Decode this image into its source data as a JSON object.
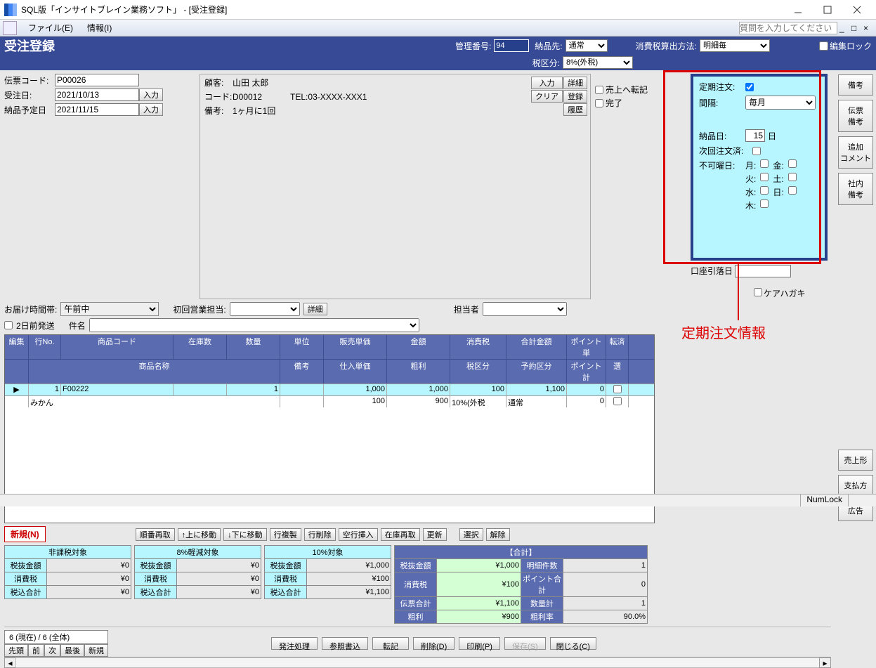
{
  "window": {
    "title": "SQL版「インサイトブレイン業務ソフト」 - [受注登録]"
  },
  "menu": {
    "file": "ファイル(E)",
    "info": "情報(I)",
    "searchPlaceholder": "質問を入力してください"
  },
  "header": {
    "pagetitle": "受注登録",
    "mgmtnum_label": "管理番号:",
    "mgmtnum": "94",
    "dest_label": "納品先:",
    "dest": "通常",
    "taxmethod_label": "消費税算出方法:",
    "taxmethod": "明細毎",
    "taxcat_label": "税区分:",
    "taxcat": "8%(外税)",
    "editlock": "編集ロック"
  },
  "form": {
    "slipcode_l": "伝票コード:",
    "slipcode": "P00026",
    "orderdate_l": "受注日:",
    "orderdate": "2021/10/13",
    "input": "入力",
    "delivdate_l": "納品予定日",
    "delivdate": "2021/11/15",
    "customer_l": "顧客:",
    "customer": "山田 太郎",
    "code_l": "コード:",
    "code": "D00012",
    "tel_l": "TEL:",
    "tel": "03-XXXX-XXX1",
    "remark_l": "備考:",
    "remark": "1ヶ月に1回",
    "btn_input": "入力",
    "btn_detail": "詳細",
    "btn_clear": "クリア",
    "btn_reg": "登録",
    "btn_hist": "履歴",
    "tosales": "売上へ転記",
    "done": "完了",
    "delivtime_l": "お届け時間帯:",
    "delivtime": "午前中",
    "firstrep_l": "初回営業担当:",
    "detail2": "詳細",
    "rep_l": "担当者",
    "twoday": "2日前発送",
    "subject_l": "件名"
  },
  "grid": {
    "edit": "編集",
    "h1": [
      "行No.",
      "商品コード",
      "在庫数",
      "数量",
      "単位",
      "販売単価",
      "金額",
      "消費税",
      "合計金額",
      "ポイント単",
      "転済"
    ],
    "h2": [
      "商品名称",
      "備考",
      "仕入単価",
      "粗利",
      "税区分",
      "予約区分",
      "ポイント計",
      "選"
    ],
    "r1": {
      "no": "1",
      "code": "F00222",
      "stock": "",
      "qty": "1",
      "unit": "",
      "up": "1,000",
      "amt": "1,000",
      "tax": "100",
      "total": "1,100",
      "pt": "0"
    },
    "r2": {
      "name": "みかん",
      "remark": "",
      "cost": "100",
      "gp": "900",
      "taxcat": "10%(外税",
      "resv": "通常",
      "ptt": "0"
    }
  },
  "toolbar": {
    "new": "新規(N)",
    "reorder": "順番再取",
    "moveup": "↑上に移動",
    "movedown": "↓下に移動",
    "duprow": "行複製",
    "delrow": "行削除",
    "insrow": "空行挿入",
    "stockre": "在庫再取",
    "update": "更新",
    "select": "選択",
    "deselect": "解除"
  },
  "totals": {
    "g1_title": "非課税対象",
    "g2_title": "8%軽減対象",
    "g3_title": "10%対象",
    "g4_title": "【合計】",
    "lbl_excl": "税抜金額",
    "lbl_tax": "消費税",
    "lbl_incl": "税込合計",
    "lbl_slip": "伝票合計",
    "lbl_gp": "粗利",
    "lbl_lines": "明細件数",
    "lbl_pts": "ポイント合計",
    "lbl_qty": "数量計",
    "lbl_gpr": "粗利率",
    "g1": {
      "excl": "¥0",
      "tax": "¥0",
      "incl": "¥0"
    },
    "g2": {
      "excl": "¥0",
      "tax": "¥0",
      "incl": "¥0"
    },
    "g3": {
      "excl": "¥1,000",
      "tax": "¥100",
      "incl": "¥1,100"
    },
    "g4": {
      "excl": "¥1,000",
      "tax": "¥100",
      "slip": "¥1,100",
      "gp": "¥900",
      "lines": "1",
      "pts": "0",
      "qty": "1",
      "gpr": "90.0%"
    }
  },
  "footer": {
    "count": "6 (現在) / 6 (全体)",
    "first": "先頭",
    "prev": "前",
    "next": "次",
    "last": "最後",
    "new": "新規",
    "po": "発注処理",
    "ref": "参照書込",
    "post": "転記",
    "del": "削除(D)",
    "print": "印刷(P)",
    "save": "保存(S)",
    "close": "閉じる(C)"
  },
  "periodic": {
    "title": "定期注文:",
    "interval_l": "間隔:",
    "interval": "毎月",
    "delivday_l": "納品日:",
    "delivday": "15",
    "day_suf": "日",
    "nextdone": "次回注文済:",
    "nogood": "不可曜日:",
    "mon": "月:",
    "tue": "火:",
    "wed": "水:",
    "thu": "木:",
    "fri": "金:",
    "sat": "土:",
    "sun": "日:",
    "debitdate": "口座引落日",
    "carecard": "ケアハガキ"
  },
  "annotation": "定期注文情報",
  "side": {
    "b1": "備考",
    "b2": "伝票\n備考",
    "b3": "追加\nコメント",
    "b4": "社内\n備考",
    "b5": "売上形",
    "b6": "支払方",
    "b7": "広告"
  },
  "status": "NumLock"
}
